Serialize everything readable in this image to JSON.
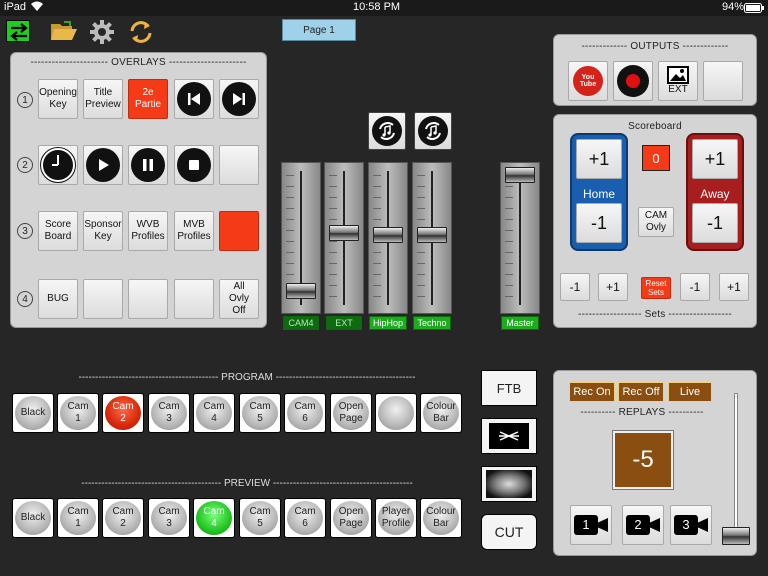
{
  "status": {
    "device": "iPad",
    "time": "10:58 PM",
    "battery": "94%"
  },
  "page_button": "Page 1",
  "overlays": {
    "title": "---------------------- OVERLAYS ----------------------",
    "row_numbers": [
      "1",
      "2",
      "3",
      "4"
    ],
    "row1": [
      "Opening\nKey",
      "Title\nPreview",
      "2e\nPartie"
    ],
    "row3": [
      "Score\nBoard",
      "Sponsor\nKey",
      "WVB\nProfiles",
      "MVB\nProfiles"
    ],
    "row4": [
      "BUG",
      "",
      "",
      "",
      "All\nOvly\nOff"
    ]
  },
  "faders": {
    "labels": [
      "CAM4",
      "EXT",
      "HipHop",
      "Techno"
    ],
    "master": "Master"
  },
  "outputs": {
    "title": "------------- OUTPUTS -------------",
    "youtube": "You\nTube",
    "ext": "EXT"
  },
  "scoreboard": {
    "title": "Scoreboard",
    "home_label": "Home",
    "away_label": "Away",
    "plus_one": "+1",
    "minus_one": "-1",
    "score": "0",
    "cam_ovly": "CAM\nOvly",
    "sets_buttons": [
      "-1",
      "+1",
      "Reset\nSets",
      "-1",
      "+1"
    ],
    "sets_label": "------------------ Sets ------------------"
  },
  "program": {
    "title": "------------------------------------------ PROGRAM ------------------------------------------",
    "buttons": [
      "Black",
      "Cam\n1",
      "Cam\n2",
      "Cam\n3",
      "Cam\n4",
      "Cam\n5",
      "Cam\n6",
      "Open\nPage",
      "",
      "Colour\nBar"
    ]
  },
  "preview": {
    "title": "------------------------------------------ PREVIEW ------------------------------------------",
    "buttons": [
      "Black",
      "Cam\n1",
      "Cam\n2",
      "Cam\n3",
      "Cam\n4",
      "Cam\n5",
      "Cam\n6",
      "Open\nPage",
      "Player\nProfile",
      "Colour\nBar"
    ]
  },
  "transitions": {
    "ftb": "FTB",
    "cut": "CUT"
  },
  "replays": {
    "rec_on": "Rec On",
    "rec_off": "Rec Off",
    "live": "Live",
    "title": "---------- REPLAYS ----------",
    "replay_value": "-5",
    "cams": [
      "1",
      "2",
      "3"
    ]
  },
  "colors": {
    "accent_green": "#22c622",
    "accent_red": "#f53a17",
    "replay_brown": "#8a4e10",
    "home_blue": "#1a5faf",
    "away_red": "#a81d1d"
  }
}
